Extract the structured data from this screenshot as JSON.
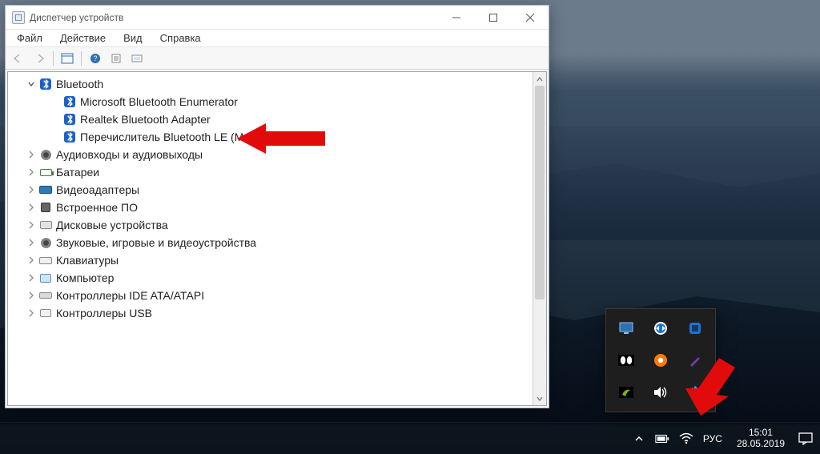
{
  "window": {
    "title": "Диспетчер устройств",
    "menu": {
      "file": "Файл",
      "action": "Действие",
      "view": "Вид",
      "help": "Справка"
    }
  },
  "tree": {
    "root": {
      "label": "Bluetooth",
      "children": [
        {
          "label": "Microsoft Bluetooth Enumerator"
        },
        {
          "label": "Realtek Bluetooth Adapter"
        },
        {
          "label": "Перечислитель Bluetooth LE (Майкрософт)"
        }
      ]
    },
    "collapsed": [
      {
        "label": "Аудиовходы и аудиовыходы",
        "icon": "speaker"
      },
      {
        "label": "Батареи",
        "icon": "battery"
      },
      {
        "label": "Видеоадаптеры",
        "icon": "gpu"
      },
      {
        "label": "Встроенное ПО",
        "icon": "chip"
      },
      {
        "label": "Дисковые устройства",
        "icon": "disk"
      },
      {
        "label": "Звуковые, игровые и видеоустройства",
        "icon": "speaker"
      },
      {
        "label": "Клавиатуры",
        "icon": "keyboard"
      },
      {
        "label": "Компьютер",
        "icon": "computer"
      },
      {
        "label": "Контроллеры IDE ATA/ATAPI",
        "icon": "ide"
      },
      {
        "label": "Контроллеры USB",
        "icon": "usb"
      }
    ]
  },
  "tray": {
    "icons": [
      "monitor-icon",
      "teamviewer-icon",
      "intel-icon",
      "dolby-icon",
      "avast-icon",
      "pen-icon",
      "nvidia-icon",
      "volume-icon",
      "bluetooth-icon"
    ]
  },
  "taskbar": {
    "language": "РУС",
    "time": "15:01",
    "date": "28.05.2019"
  }
}
